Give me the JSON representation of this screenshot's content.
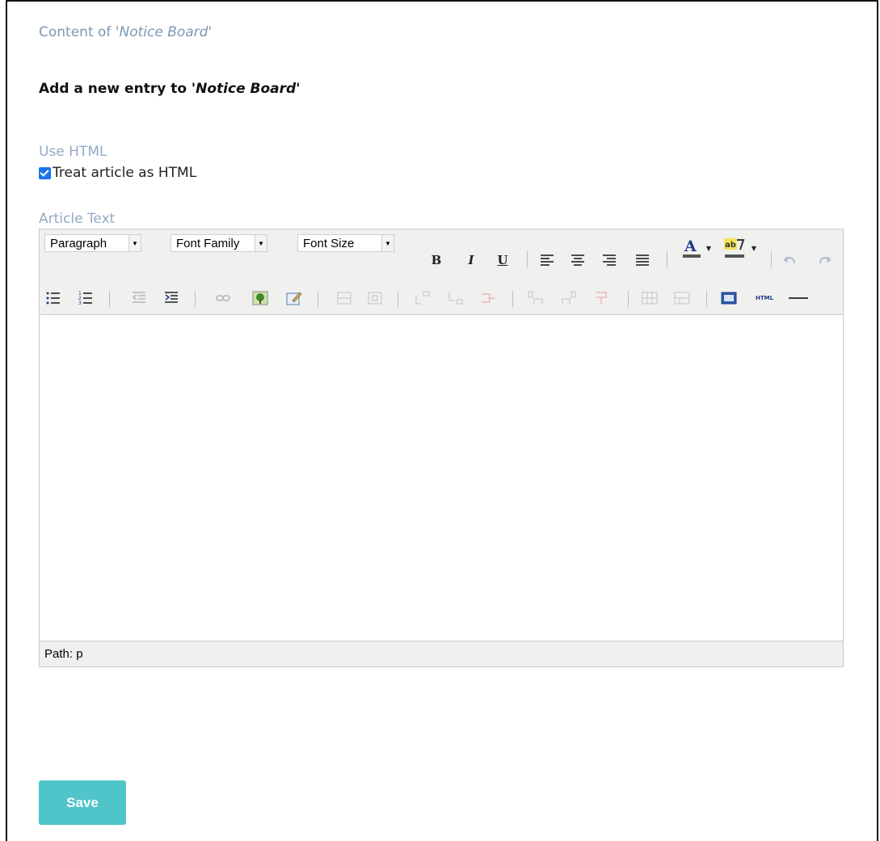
{
  "breadcrumb": {
    "prefix": "Content of '",
    "board": "Notice Board",
    "suffix": "'"
  },
  "heading": {
    "prefix": "Add a new entry to '",
    "board": "Notice Board",
    "suffix": "'"
  },
  "use_html": {
    "label": "Use HTML",
    "checkbox_label": "Treat article as HTML",
    "checked": true
  },
  "article": {
    "label": "Article Text"
  },
  "editor": {
    "format_select": "Paragraph",
    "font_family_select": "Font Family",
    "font_size_select": "Font Size",
    "bold": "B",
    "italic": "I",
    "underline": "U",
    "html_button": "HTML",
    "status_path": "Path: p",
    "content": ""
  },
  "save_label": "Save",
  "colors": {
    "accent": "#4fc4c9",
    "label": "#93aac6",
    "breadcrumb": "#7d97b5"
  }
}
